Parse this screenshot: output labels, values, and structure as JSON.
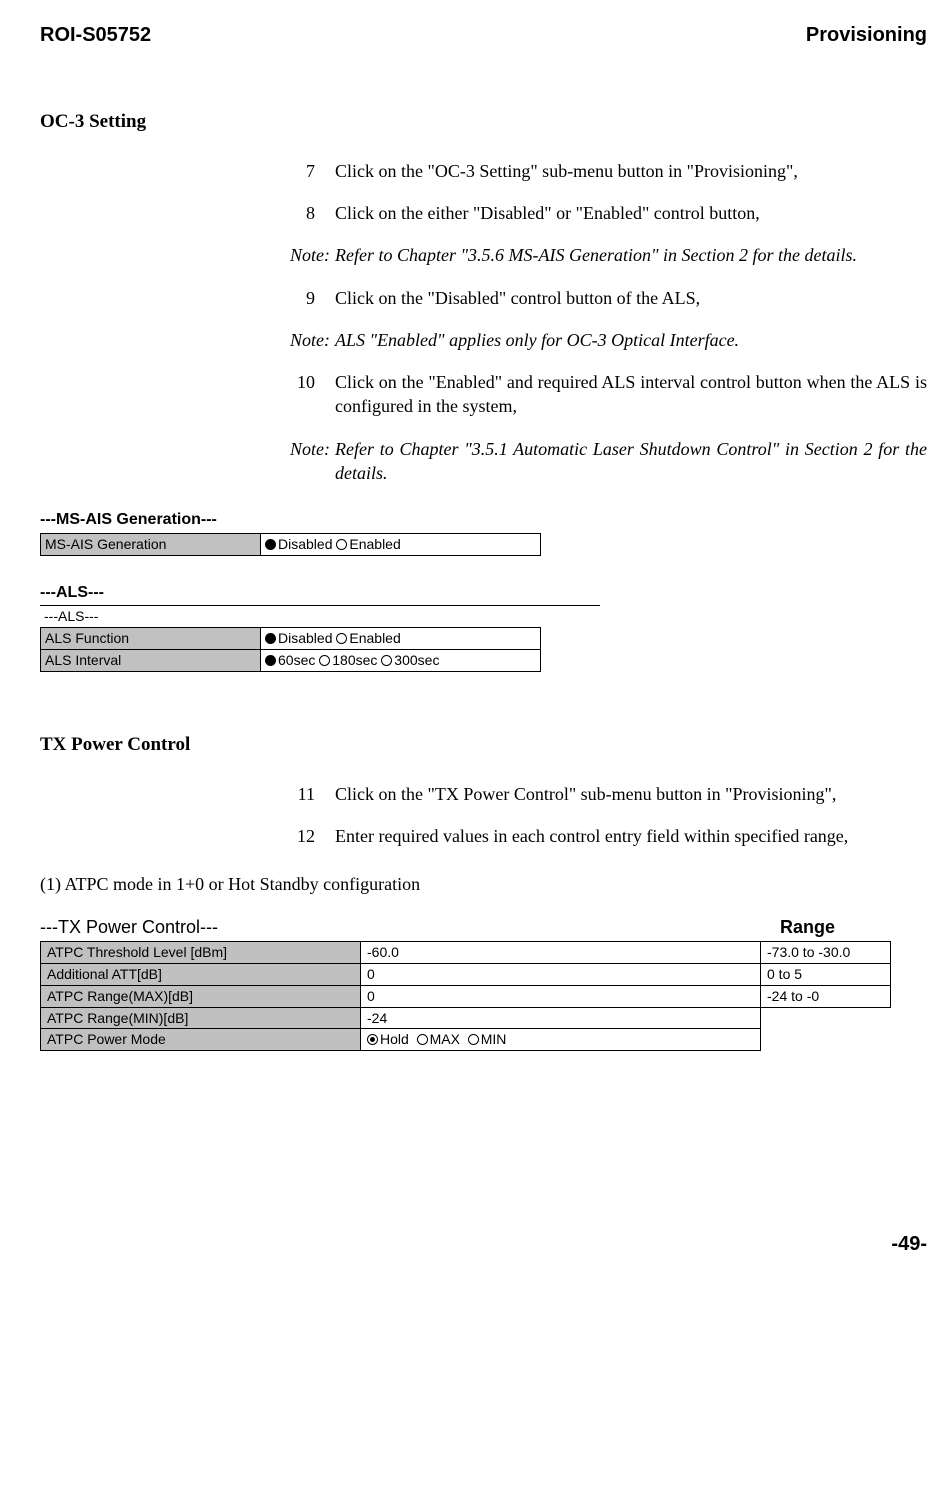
{
  "header": {
    "left": "ROI-S05752",
    "right": "Provisioning"
  },
  "oc3": {
    "heading": "OC-3 Setting",
    "steps": {
      "s7": {
        "num": "7",
        "text": "Click on the \"OC-3 Setting\" sub-menu button in \"Provisioning\","
      },
      "s8": {
        "num": "8",
        "text": "Click on the either \"Disabled\" or \"Enabled\" control button,"
      },
      "n1": {
        "label": "Note:",
        "text": "Refer to Chapter \"3.5.6 MS-AIS Generation\" in Section 2 for the details."
      },
      "s9": {
        "num": "9",
        "text": "Click on the \"Disabled\" control button of the ALS,"
      },
      "n2": {
        "label": "Note:",
        "text": "ALS \"Enabled\" applies only for OC-3 Optical Interface."
      },
      "s10": {
        "num": "10",
        "text": "Click on the \"Enabled\" and required ALS interval control button when the ALS is configured in the system,"
      },
      "n3": {
        "label": "Note:",
        "text": "Refer to Chapter \"3.5.1 Automatic Laser Shutdown Control\" in Section 2 for the details."
      }
    },
    "msais": {
      "group_title": "---MS-AIS Generation---",
      "row_label": "MS-AIS Generation",
      "opt_disabled": "Disabled",
      "opt_enabled": "Enabled",
      "selected": "Disabled"
    },
    "als": {
      "group_title": "---ALS---",
      "sub_title": "---ALS---",
      "func_label": "ALS Function",
      "func_opt_disabled": "Disabled",
      "func_opt_enabled": "Enabled",
      "func_selected": "Disabled",
      "interval_label": "ALS Interval",
      "int_opt_60": "60sec",
      "int_opt_180": "180sec",
      "int_opt_300": "300sec",
      "int_selected": "60sec"
    }
  },
  "txpower": {
    "heading": "TX Power Control",
    "steps": {
      "s11": {
        "num": "11",
        "text": "Click on the \"TX Power Control\" sub-menu button in \"Provisioning\","
      },
      "s12": {
        "num": "12",
        "text": "Enter required values in each control entry field within specified range,"
      }
    },
    "subsection": "(1)   ATPC mode in 1+0 or Hot Standby configuration",
    "table_title": "---TX Power Control---",
    "range_header": "Range",
    "rows": {
      "r0": {
        "label": "ATPC Threshold Level [dBm]",
        "value": "-60.0",
        "range": "-73.0 to -30.0"
      },
      "r1": {
        "label": "Additional ATT[dB]",
        "value": "0",
        "range": "0 to 5"
      },
      "r2": {
        "label": "ATPC Range(MAX)[dB]",
        "value": "0",
        "range": "-24 to -0"
      },
      "r3": {
        "label": "ATPC Range(MIN)[dB]",
        "value": "-24"
      },
      "r4": {
        "label": "ATPC Power Mode",
        "opt_hold": "Hold",
        "opt_max": "MAX",
        "opt_min": "MIN",
        "selected": "Hold"
      }
    }
  },
  "footer": {
    "page": "-49-"
  }
}
